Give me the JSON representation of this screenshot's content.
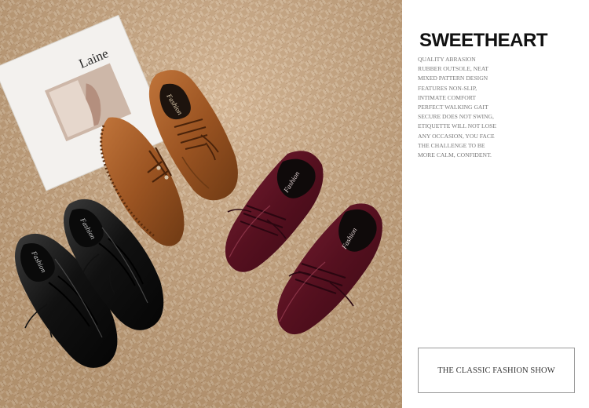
{
  "photo": {
    "magazine_text": "Laine",
    "shoe_insole_text": "Fashion"
  },
  "panel": {
    "brand": "SWEETHEART",
    "description_lines": [
      "QUALITY ABRASION",
      "RUBBER OUTSOLE, NEAT",
      "MIXED PATTERN DESIGN",
      "FEATURES NON-SLIP,",
      "INTIMATE COMFORT",
      "PERFECT WALKING GAIT",
      "SECURE DOES NOT SWING,",
      "ETIQUETTE WILL NOT LOSE",
      "ANY OCCASION, YOU FACE",
      "THE CHALLENGE TO BE",
      "MORE CALM, CONFIDENT."
    ],
    "box_caption": "THE CLASSIC FASHION SHOW"
  }
}
